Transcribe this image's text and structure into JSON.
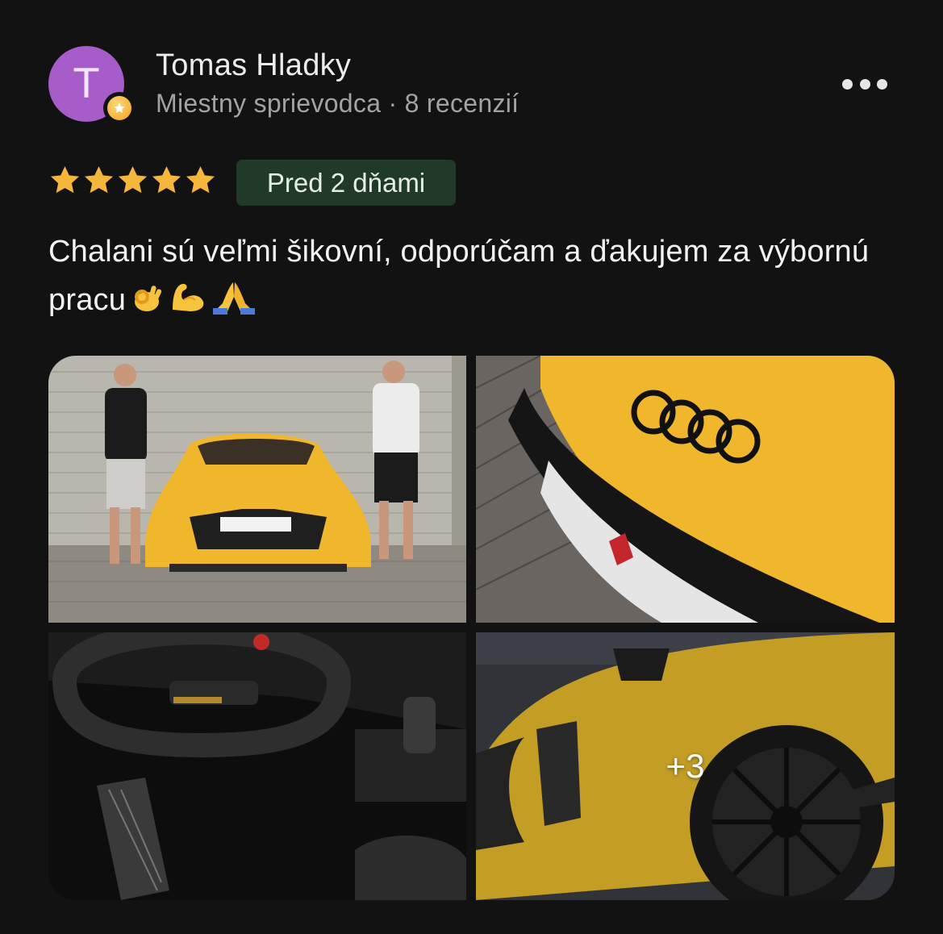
{
  "reviewer": {
    "avatar_letter": "T",
    "avatar_color": "#a65dc9",
    "name": "Tomas Hladky",
    "meta": "Miestny sprievodca · 8 recenzií",
    "badge_icon": "local-guide-star-icon"
  },
  "menu_icon": "more-horizontal-icon",
  "rating": {
    "stars": 5,
    "max": 5,
    "star_color": "#f6b53c"
  },
  "date_label": "Pred 2 dňami",
  "review_text": "Chalani sú veľmi šikovní, odporúčam a ďakujem za výbornú pracu",
  "review_emojis": [
    "ok-hand-emoji",
    "flexed-biceps-emoji",
    "folded-hands-emoji"
  ],
  "photos": [
    {
      "name": "photo-two-men-with-yellow-audi-r8"
    },
    {
      "name": "photo-audi-grille-closeup"
    },
    {
      "name": "photo-audi-interior-steering-wheel"
    },
    {
      "name": "photo-yellow-audi-side-wheel",
      "more_label": "+3"
    }
  ]
}
